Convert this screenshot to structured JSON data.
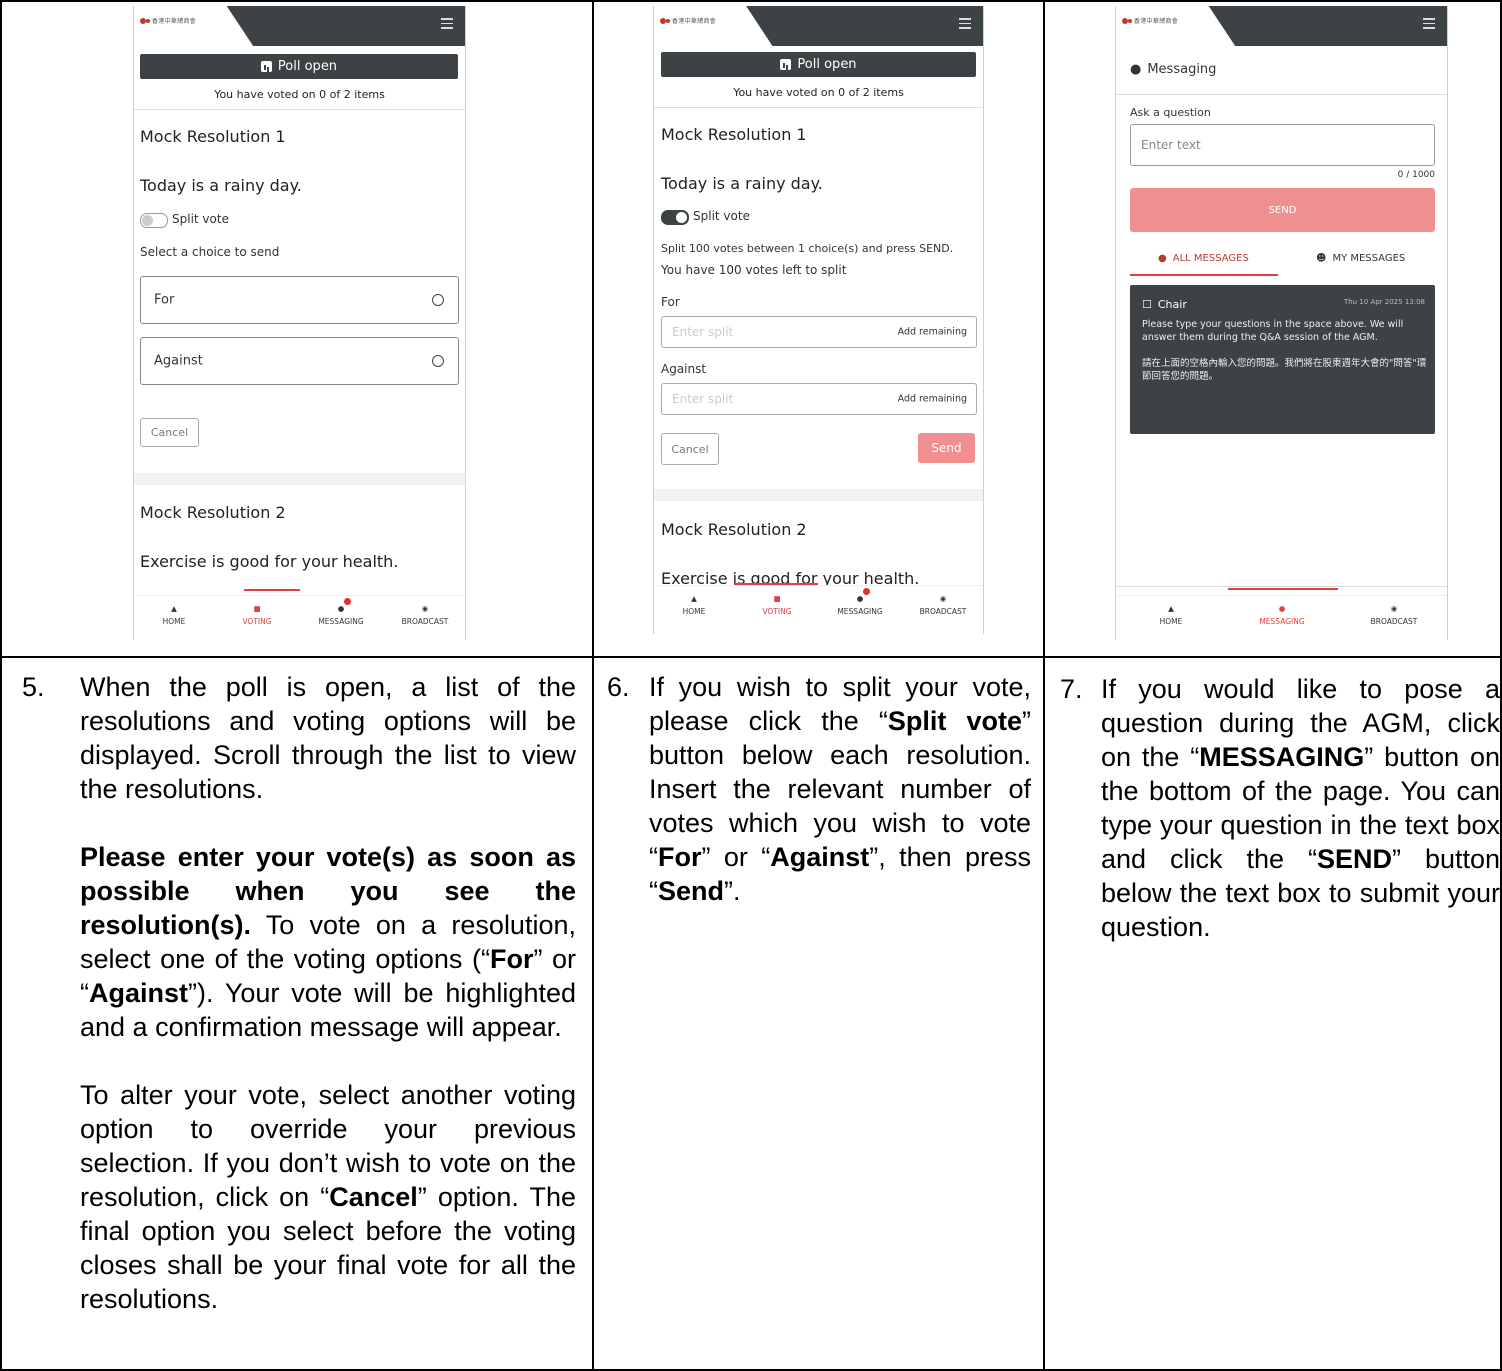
{
  "app": {
    "logo_text": "香港中華總商會",
    "menu_icon": "hamburger-icon"
  },
  "poll": {
    "status": "Poll open",
    "voted_summary": "You have voted on 0 of 2 items"
  },
  "resolutions": [
    {
      "title": "Mock Resolution 1",
      "text": "Today is a rainy day."
    },
    {
      "title": "Mock Resolution 2",
      "text": "Exercise is good for your health."
    }
  ],
  "voting": {
    "split_label": "Split vote",
    "select_prompt": "Select a choice to send",
    "choices": [
      "For",
      "Against"
    ],
    "cancel": "Cancel",
    "send": "Send",
    "split_instructions": "Split 100 votes between 1 choice(s) and press SEND.",
    "votes_left": "You have 100 votes left to split",
    "split_placeholder": "Enter split",
    "add_remaining": "Add remaining"
  },
  "nav": {
    "home": "HOME",
    "voting": "VOTING",
    "messaging": "MESSAGING",
    "broadcast": "BROADCAST"
  },
  "messaging": {
    "title": "Messaging",
    "ask_label": "Ask a question",
    "placeholder": "Enter text",
    "counter": "0 / 1000",
    "send": "SEND",
    "tab_all": "ALL MESSAGES",
    "tab_mine": "MY MESSAGES",
    "message": {
      "sender": "Chair",
      "time": "Thu 10 Apr 2025 13:08",
      "body": "Please type your questions in the space above.  We will answer them during the Q&A session of the AGM.\n\n請在上面的空格內輸入您的問題。我們將在股東週年大會的\"問答\"環節回答您的問題。"
    }
  },
  "steps": [
    {
      "number": "5.",
      "p1": "When the poll is open, a list of the resolutions and voting options will be displayed. Scroll through the list to view the resolutions.",
      "p2_bold": "Please enter your vote(s) as soon as possible when you see the resolution(s).",
      "p2_a": " To vote on a resolution, select one of the voting options (“",
      "p2_for": "For",
      "p2_b": "” or “",
      "p2_against": "Against",
      "p2_c": "”). Your vote will be highlighted and a confirmation message will appear.",
      "p3_a": "To alter your vote, select another voting option to override your previous selection. If you don’t wish to vote on the resolution, click on “",
      "p3_cancel": "Cancel",
      "p3_b": "” option. The final option you select before the voting closes shall be your final vote for all the resolutions."
    },
    {
      "number": "6.",
      "a": "If you wish to split your vote, please click the “",
      "split": "Split vote",
      "b": "” button below each resolution. Insert the relevant number of votes which you wish to vote “",
      "for": "For",
      "c": "” or “",
      "against": "Against",
      "d": "”, then press “",
      "send": "Send",
      "e": "”."
    },
    {
      "number": "7.",
      "a": "If you would like to pose a question during the AGM, click on the “",
      "messaging": "MESSAGING",
      "b": "” button on the bottom of the page. You can type your question in the text box and click the “",
      "send": "SEND",
      "c": "” button below the text box to submit your question."
    }
  ]
}
